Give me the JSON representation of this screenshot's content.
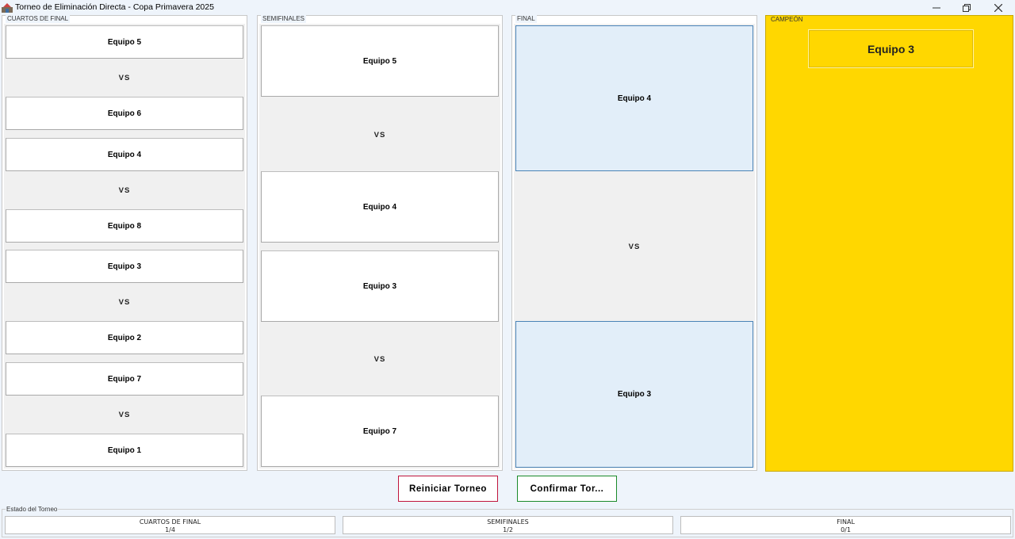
{
  "window": {
    "title": "Torneo de Eliminación Directa - Copa Primavera 2025",
    "icons": [
      "app-icon",
      "minimize-icon",
      "restore-icon",
      "close-icon"
    ]
  },
  "quarterfinals": {
    "label": "CUARTOS DE FINAL",
    "vs": "VS",
    "matches": [
      {
        "team_a": "Equipo 5",
        "team_b": "Equipo 6"
      },
      {
        "team_a": "Equipo 4",
        "team_b": "Equipo 8"
      },
      {
        "team_a": "Equipo 3",
        "team_b": "Equipo 2"
      },
      {
        "team_a": "Equipo 7",
        "team_b": "Equipo 1"
      }
    ]
  },
  "semifinals": {
    "label": "SEMIFINALES",
    "vs": "VS",
    "matches": [
      {
        "team_a": "Equipo 5",
        "team_b": "Equipo 4"
      },
      {
        "team_a": "Equipo 3",
        "team_b": "Equipo 7"
      }
    ]
  },
  "final": {
    "label": "FINAL",
    "vs": "VS",
    "team_a": "Equipo 4",
    "team_b": "Equipo 3"
  },
  "champion": {
    "label": "CAMPEÓN",
    "team": "Equipo 3"
  },
  "actions": {
    "reset_label": "Reiniciar Torneo",
    "confirm_label": "Confirmar Tor..."
  },
  "status": {
    "label": "Estado del Torneo",
    "stages": [
      {
        "name": "CUARTOS DE FINAL",
        "progress": "1/4"
      },
      {
        "name": "SEMIFINALES",
        "progress": "1/2"
      },
      {
        "name": "FINAL",
        "progress": "0/1"
      }
    ]
  },
  "colors": {
    "champion_bg": "#ffd700",
    "final_box_bg": "#e2eef9",
    "final_box_border": "#4a83b6",
    "reset_border": "#c0143c",
    "confirm_border": "#1a8a2a",
    "window_bg": "#eef4fb"
  }
}
